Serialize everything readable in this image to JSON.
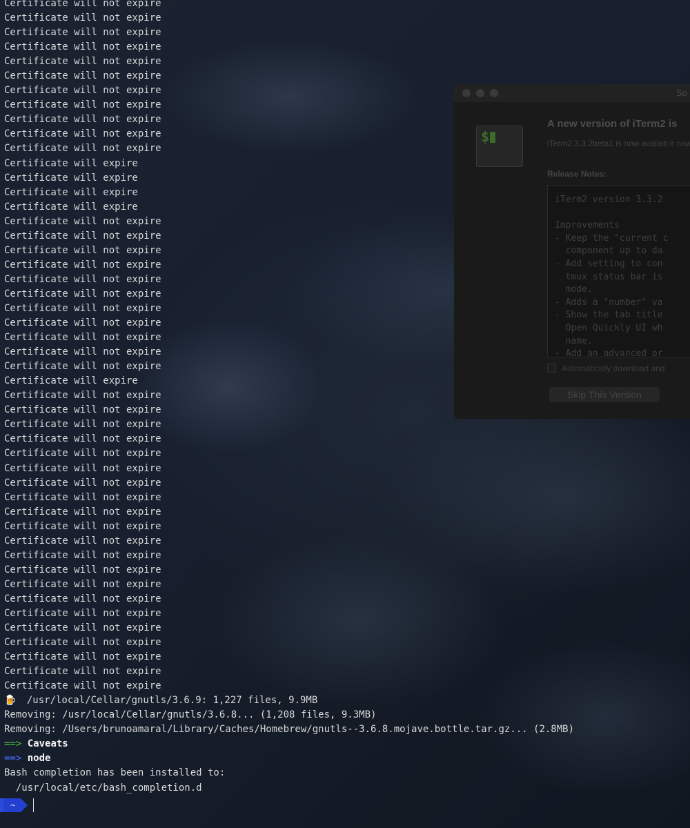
{
  "terminal": {
    "lines": [
      {
        "text": "Certificate will not expire"
      },
      {
        "text": "Certificate will not expire"
      },
      {
        "text": "Certificate will not expire"
      },
      {
        "text": "Certificate will not expire"
      },
      {
        "text": "Certificate will not expire"
      },
      {
        "text": "Certificate will not expire"
      },
      {
        "text": "Certificate will not expire"
      },
      {
        "text": "Certificate will not expire"
      },
      {
        "text": "Certificate will not expire"
      },
      {
        "text": "Certificate will not expire"
      },
      {
        "text": "Certificate will not expire"
      },
      {
        "text": "Certificate will expire"
      },
      {
        "text": "Certificate will expire"
      },
      {
        "text": "Certificate will expire"
      },
      {
        "text": "Certificate will expire"
      },
      {
        "text": "Certificate will not expire"
      },
      {
        "text": "Certificate will not expire"
      },
      {
        "text": "Certificate will not expire"
      },
      {
        "text": "Certificate will not expire"
      },
      {
        "text": "Certificate will not expire"
      },
      {
        "text": "Certificate will not expire"
      },
      {
        "text": "Certificate will not expire"
      },
      {
        "text": "Certificate will not expire"
      },
      {
        "text": "Certificate will not expire"
      },
      {
        "text": "Certificate will not expire"
      },
      {
        "text": "Certificate will not expire"
      },
      {
        "text": "Certificate will expire"
      },
      {
        "text": "Certificate will not expire"
      },
      {
        "text": "Certificate will not expire"
      },
      {
        "text": "Certificate will not expire"
      },
      {
        "text": "Certificate will not expire"
      },
      {
        "text": "Certificate will not expire"
      },
      {
        "text": "Certificate will not expire"
      },
      {
        "text": "Certificate will not expire"
      },
      {
        "text": "Certificate will not expire"
      },
      {
        "text": "Certificate will not expire"
      },
      {
        "text": "Certificate will not expire"
      },
      {
        "text": "Certificate will not expire"
      },
      {
        "text": "Certificate will not expire"
      },
      {
        "text": "Certificate will not expire"
      },
      {
        "text": "Certificate will not expire"
      },
      {
        "text": "Certificate will not expire"
      },
      {
        "text": "Certificate will not expire"
      },
      {
        "text": "Certificate will not expire"
      },
      {
        "text": "Certificate will not expire"
      },
      {
        "text": "Certificate will not expire"
      },
      {
        "text": "Certificate will not expire"
      },
      {
        "text": "Certificate will not expire"
      },
      {
        "icon": "beer-mug-icon",
        "text": "  /usr/local/Cellar/gnutls/3.6.9: 1,227 files, 9.9MB"
      },
      {
        "text": "Removing: /usr/local/Cellar/gnutls/3.6.8... (1,208 files, 9.3MB)"
      },
      {
        "text": "Removing: /Users/brunoamaral/Library/Caches/Homebrew/gnutls--3.6.8.mojave.bottle.tar.gz... (2.8MB)"
      },
      {
        "arrow": "==>",
        "arrow_color": "green",
        "text": " Caveats",
        "bold": true
      },
      {
        "arrow": "==>",
        "arrow_color": "blue",
        "text": " node",
        "bold": true
      },
      {
        "text": "Bash completion has been installed to:"
      },
      {
        "text": "  /usr/local/etc/bash_completion.d"
      }
    ],
    "prompt": {
      "path": "~",
      "segment_color": "#2340d0"
    },
    "colors": {
      "text": "#d8d8d8",
      "arrow_green": "#4fc44a",
      "arrow_blue": "#4d6fff"
    }
  },
  "update_dialog": {
    "title": "So",
    "icon": "iterm-app-icon",
    "icon_text": "$",
    "heading": "A new version of iTerm2 is",
    "subtext": "iTerm2 3.3.2beta1 is now availab it now?",
    "release_notes_label": "Release Notes:",
    "release_notes": "iTerm2 version 3.3.2\n\nImprovements\n- Keep the \"current c\n  component up to da\n- Add setting to con\n  tmux status bar is\n  mode.\n- Adds a \"number\" va\n- Show the tab title\n  Open Quickly UI wh\n  name.\n- Add an advanced pr",
    "auto_download_label": "Automatically download and",
    "skip_button_label": "Skip This Version"
  }
}
